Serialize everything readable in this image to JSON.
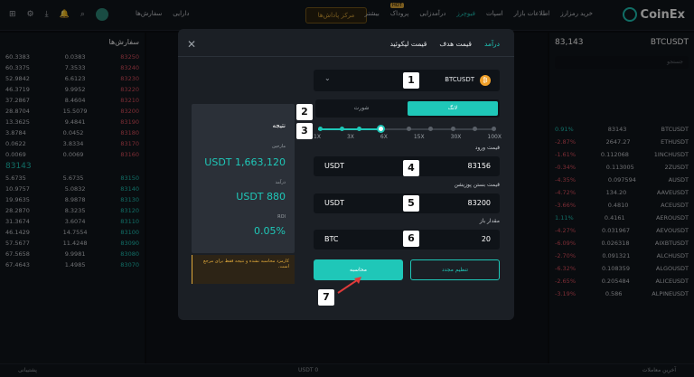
{
  "brand": "CoinEx",
  "nav": [
    "خرید رمزارز",
    "اطلاعات بازار",
    "اسپات",
    "فیوچرز",
    "درآمدزایی",
    "پروداک",
    "بیشتر"
  ],
  "nav_hot": "HOT",
  "promo": "مرکز پاداش‌ها",
  "lang": [
    "دارایی",
    "سفارش‌ها"
  ],
  "pair": {
    "symbol": "BTCUSDT",
    "price": "83,143"
  },
  "market": {
    "search": "جستجو",
    "rows": [
      {
        "name": "BTCUSDT",
        "price": "83143",
        "change": "0.91%",
        "up": true
      },
      {
        "name": "ETHUSDT",
        "price": "2647.27",
        "change": "-2.87%",
        "up": false
      },
      {
        "name": "1INCHUSDT",
        "price": "0.112068",
        "change": "-1.61%",
        "up": false
      },
      {
        "name": "2ZUSDT",
        "price": "0.113005",
        "change": "-0.34%",
        "up": false
      },
      {
        "name": "AUSDT",
        "price": "0.097594",
        "change": "-4.35%",
        "up": false
      },
      {
        "name": "AAVEUSDT",
        "price": "134.20",
        "change": "-4.72%",
        "up": false
      },
      {
        "name": "ACEUSDT",
        "price": "0.4810",
        "change": "-3.66%",
        "up": false
      },
      {
        "name": "AEROUSDT",
        "price": "0.4161",
        "change": "1.11%",
        "up": true
      },
      {
        "name": "AEVOUSDT",
        "price": "0.031967",
        "change": "-4.27%",
        "up": false
      },
      {
        "name": "AIXBTUSDT",
        "price": "0.026318",
        "change": "-6.09%",
        "up": false
      },
      {
        "name": "ALCHUSDT",
        "price": "0.091321",
        "change": "-2.70%",
        "up": false
      },
      {
        "name": "ALGOUSDT",
        "price": "0.108359",
        "change": "-6.32%",
        "up": false
      },
      {
        "name": "ALICEUSDT",
        "price": "0.205484",
        "change": "-2.65%",
        "up": false
      },
      {
        "name": "ALPINEUSDT",
        "price": "0.586",
        "change": "-3.19%",
        "up": false
      }
    ]
  },
  "book": {
    "title": "سفارش‌ها",
    "asks": [
      [
        "83250",
        "0.0383",
        "60.3383"
      ],
      [
        "83240",
        "7.3533",
        "60.3375"
      ],
      [
        "83230",
        "6.6123",
        "52.9842"
      ],
      [
        "83220",
        "9.9952",
        "46.3719"
      ],
      [
        "83210",
        "8.4604",
        "37.2867"
      ],
      [
        "83200",
        "15.5079",
        "28.8704"
      ],
      [
        "83190",
        "9.4841",
        "13.3625"
      ],
      [
        "83180",
        "0.0452",
        "3.8784"
      ],
      [
        "83170",
        "3.8334",
        "0.0622"
      ],
      [
        "83160",
        "0.0069",
        "0.0069"
      ]
    ],
    "last": "83143",
    "bids": [
      [
        "83150",
        "5.6735",
        "5.6735"
      ],
      [
        "83140",
        "5.0832",
        "10.9757"
      ],
      [
        "83130",
        "8.9878",
        "19.9635"
      ],
      [
        "83120",
        "8.3235",
        "28.2870"
      ],
      [
        "83110",
        "3.6074",
        "31.3674"
      ],
      [
        "83100",
        "14.7554",
        "46.1429"
      ],
      [
        "83090",
        "11.4248",
        "57.5677"
      ],
      [
        "83080",
        "9.9981",
        "67.5658"
      ],
      [
        "83070",
        "1.4985",
        "67.4643"
      ]
    ]
  },
  "modal": {
    "tabs": [
      "درآمد",
      "قیمت هدف",
      "قیمت لیکوئید"
    ],
    "pair": "BTCUSDT",
    "coin_glyph": "₿",
    "long": "لانگ",
    "short": "شورت",
    "leverage_ticks": [
      "1X",
      "3X",
      "6X",
      "15X",
      "30X",
      "100X"
    ],
    "entry_label": "قیمت ورود",
    "entry_unit": "USDT",
    "entry_value": "83156",
    "exit_label": "قیمت بستن پوزیشن",
    "exit_unit": "USDT",
    "exit_value": "83200",
    "qty_label": "مقدار باز",
    "qty_unit": "BTC",
    "qty_value": "20",
    "calc": "محاسبه",
    "reset": "تنظیم مجدد",
    "result_title": "نتیجه",
    "margin_label": "مارجین",
    "margin_value": "USDT 1,663,120",
    "pnl_label": "درآمد",
    "pnl_value": "USDT 880",
    "roi_label": "ROI",
    "roi_value": "0.05%",
    "note": "کارمزد محاسبه نشده و نتیجه فقط برای مرجع است."
  },
  "badges": [
    "1",
    "2",
    "3",
    "4",
    "5",
    "6",
    "7"
  ],
  "bottom": {
    "left": "پشتیبانی",
    "mid": "USDT 0",
    "right": "آخرین معاملات"
  }
}
